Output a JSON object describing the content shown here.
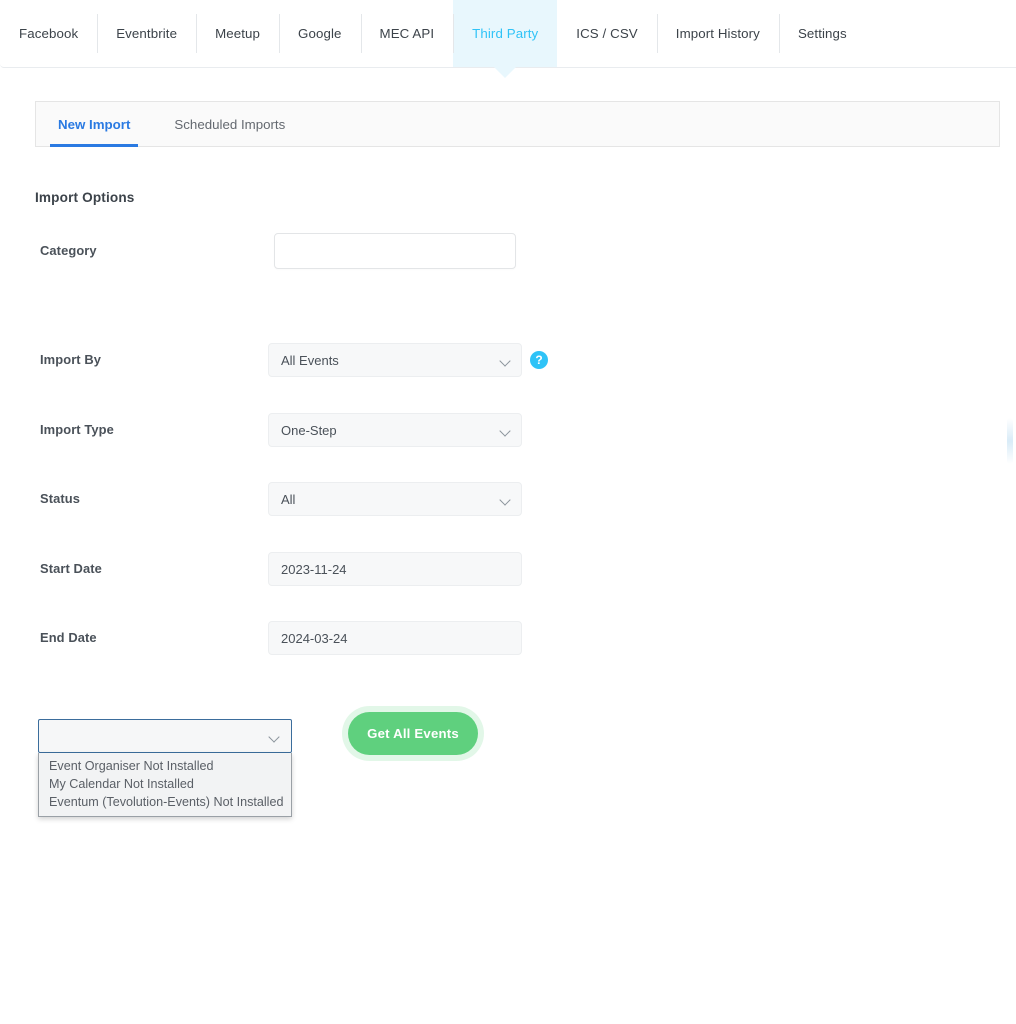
{
  "topnav": {
    "items": [
      {
        "label": "Facebook",
        "active": false
      },
      {
        "label": "Eventbrite",
        "active": false
      },
      {
        "label": "Meetup",
        "active": false
      },
      {
        "label": "Google",
        "active": false
      },
      {
        "label": "MEC API",
        "active": false
      },
      {
        "label": "Third Party",
        "active": true
      },
      {
        "label": "ICS / CSV",
        "active": false
      },
      {
        "label": "Import History",
        "active": false
      },
      {
        "label": "Settings",
        "active": false
      }
    ],
    "active_color": "#2fc3f7",
    "active_bg": "#e8f7fd"
  },
  "subtabs": {
    "items": [
      {
        "label": "New Import",
        "active": true
      },
      {
        "label": "Scheduled Imports",
        "active": false
      }
    ],
    "active_color": "#2a7ae2"
  },
  "form": {
    "section_title": "Import Options",
    "fields": [
      {
        "label": "Category",
        "type": "text",
        "value": "",
        "placeholder": "",
        "help": false
      },
      {
        "label": "Import By",
        "type": "select",
        "value": "All Events",
        "help": true,
        "help_icon": "question-circle-icon"
      },
      {
        "label": "Import Type",
        "type": "select",
        "value": "One-Step",
        "help": false
      },
      {
        "label": "Status",
        "type": "select",
        "value": "All",
        "help": false
      },
      {
        "label": "Start Date",
        "type": "date",
        "value": "2023-11-24",
        "help": false
      },
      {
        "label": "End Date",
        "type": "date",
        "value": "2024-03-24",
        "help": false
      }
    ]
  },
  "plugin_select": {
    "value": "",
    "expanded": true,
    "options": [
      "Event Organiser Not Installed",
      "My Calendar Not Installed",
      "Eventum (Tevolution-Events) Not Installed"
    ]
  },
  "actions": {
    "get_all_events_label": "Get All Events",
    "button_color": "#5fd07e"
  },
  "icons": {
    "chevron_down": "chevron-down-icon",
    "help": "question-circle-icon"
  }
}
